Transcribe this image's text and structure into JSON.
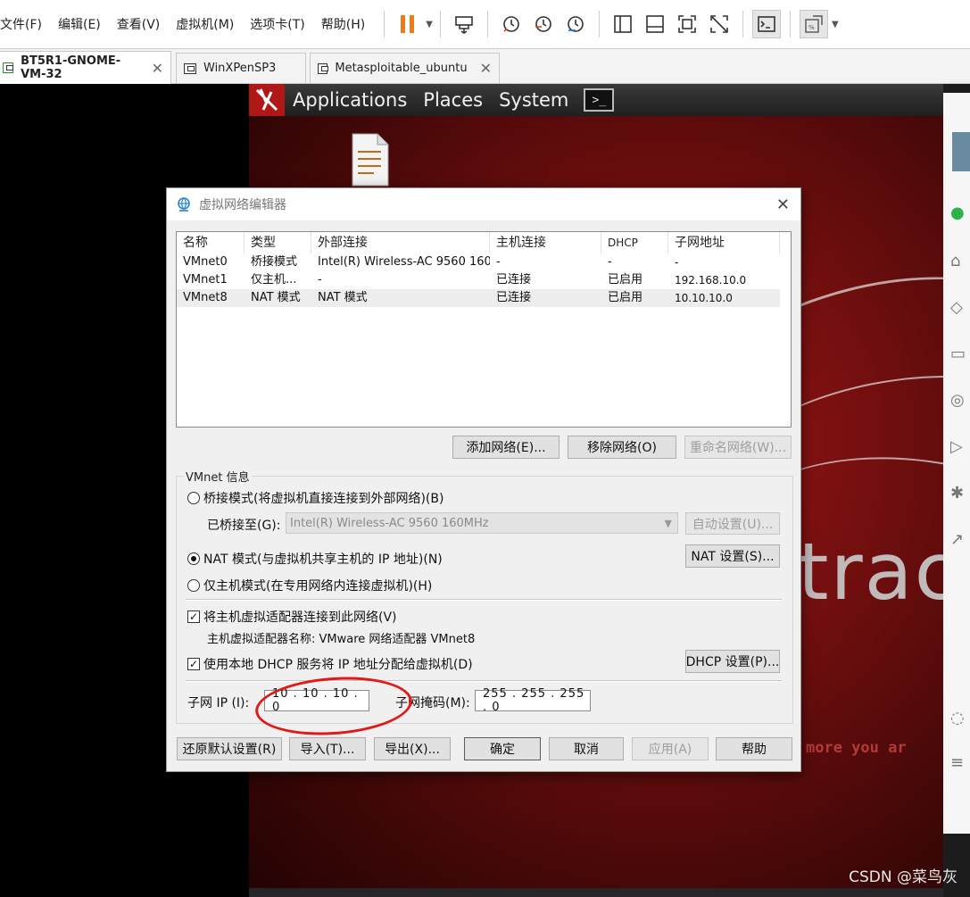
{
  "menubar": {
    "items": [
      "文件(F)",
      "编辑(E)",
      "查看(V)",
      "虚拟机(M)",
      "选项卡(T)",
      "帮助(H)"
    ]
  },
  "toolbar": {
    "icons": [
      "pause-icon",
      "send-keys-icon",
      "snapshot-icon",
      "revert-snapshot-icon",
      "snapshot-manager-icon",
      "normal-view-icon",
      "console-view-icon",
      "fullscreen-icon",
      "unity-icon",
      "terminal-icon",
      "scale-view-icon"
    ],
    "pause_color": "#f07b1b"
  },
  "tabs": [
    {
      "label": "BT5R1-GNOME-VM-32",
      "active": true
    },
    {
      "label": "WinXPenSP3",
      "active": false
    },
    {
      "label": "Metasploitable_ubuntu",
      "active": false
    }
  ],
  "guest": {
    "panel_menus": [
      "Applications",
      "Places",
      "System"
    ],
    "background_text": "trac",
    "tagline": "more you ar",
    "background_color": "#8a1212"
  },
  "dialog": {
    "title": "虚拟网络编辑器",
    "columns": [
      "名称",
      "类型",
      "外部连接",
      "主机连接",
      "DHCP",
      "子网地址"
    ],
    "rows": [
      {
        "name": "VMnet0",
        "type": "桥接模式",
        "external": "Intel(R) Wireless-AC 9560 160...",
        "host": "-",
        "dhcp": "-",
        "subnet": "-",
        "selected": false
      },
      {
        "name": "VMnet1",
        "type": "仅主机...",
        "external": "-",
        "host": "已连接",
        "dhcp": "已启用",
        "subnet": "192.168.10.0",
        "selected": false
      },
      {
        "name": "VMnet8",
        "type": "NAT 模式",
        "external": "NAT 模式",
        "host": "已连接",
        "dhcp": "已启用",
        "subnet": "10.10.10.0",
        "selected": true
      }
    ],
    "buttons": {
      "add_network": "添加网络(E)...",
      "remove_network": "移除网络(O)",
      "rename_network": "重命名网络(W)..."
    },
    "vmnet_info": {
      "legend": "VMnet 信息",
      "bridged": "桥接模式(将虚拟机直接连接到外部网络)(B)",
      "bridged_to_label": "已桥接至(G):",
      "bridged_to_value": "Intel(R) Wireless-AC 9560 160MHz",
      "auto_settings": "自动设置(U)...",
      "nat": "NAT 模式(与虚拟机共享主机的 IP 地址)(N)",
      "nat_settings": "NAT 设置(S)...",
      "host_only": "仅主机模式(在专用网络内连接虚拟机)(H)",
      "selected_mode": "nat",
      "connect_adapter": "将主机虚拟适配器连接到此网络(V)",
      "connect_adapter_checked": true,
      "adapter_name": "主机虚拟适配器名称: VMware 网络适配器 VMnet8",
      "use_dhcp": "使用本地 DHCP 服务将 IP 地址分配给虚拟机(D)",
      "use_dhcp_checked": true,
      "dhcp_settings": "DHCP 设置(P)...",
      "subnet_ip_label": "子网 IP (I):",
      "subnet_ip": "10 . 10 . 10 . 0",
      "subnet_mask_label": "子网掩码(M):",
      "subnet_mask": "255 . 255 . 255 . 0"
    },
    "footer": {
      "restore_defaults": "还原默认设置(R)",
      "import": "导入(T)...",
      "export": "导出(X)...",
      "ok": "确定",
      "cancel": "取消",
      "apply": "应用(A)",
      "help": "帮助"
    },
    "annotation_color": "#e01919"
  },
  "watermark": "CSDN @菜鸟灰"
}
